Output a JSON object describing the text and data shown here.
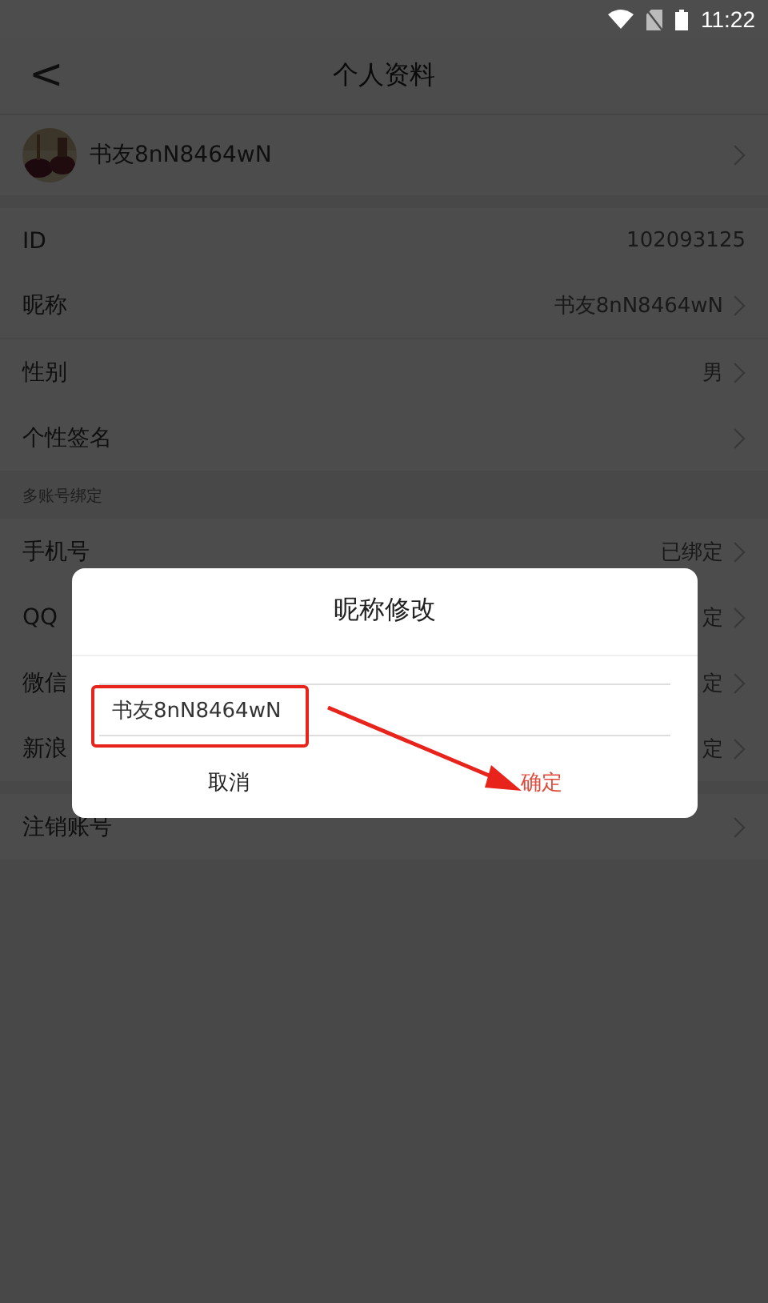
{
  "status_bar": {
    "time": "11:22"
  },
  "header": {
    "back": "<",
    "title": "个人资料"
  },
  "profile": {
    "name": "书友8nN8464wN"
  },
  "info_rows": [
    {
      "label": "ID",
      "value": "102093125",
      "arrow": false
    },
    {
      "label": "昵称",
      "value": "书友8nN8464wN",
      "arrow": true
    },
    {
      "label": "性别",
      "value": "男",
      "arrow": true
    },
    {
      "label": "个性签名",
      "arrow": true
    }
  ],
  "binding_section": {
    "title": "多账号绑定",
    "rows": [
      {
        "label": "手机号",
        "value": "已绑定"
      },
      {
        "label": "QQ",
        "value": "定"
      },
      {
        "label": "微信",
        "value": "定"
      },
      {
        "label": "新浪",
        "value": "定"
      }
    ]
  },
  "account_rows": [
    {
      "label": "注销账号"
    }
  ],
  "dialog": {
    "title": "昵称修改",
    "value": "书友8nN8464wN",
    "buttons": [
      {
        "label": "取消",
        "kind": "cancel"
      },
      {
        "label": "确定",
        "kind": "confirm"
      }
    ]
  }
}
